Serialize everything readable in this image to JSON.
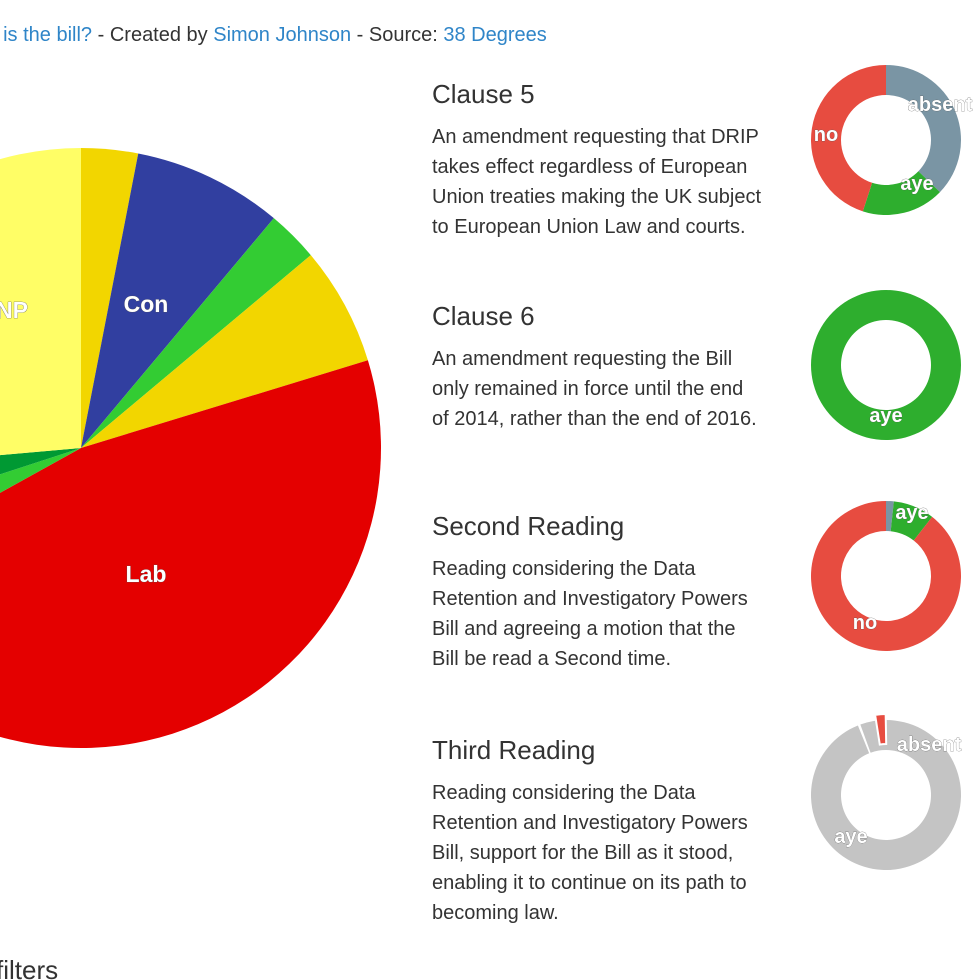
{
  "header": {
    "question_link": "t is the bill?",
    "created_by_text": " - Created by ",
    "author_link": "Simon Johnson",
    "source_text": " - Source: ",
    "source_link": "38 Degrees"
  },
  "colors": {
    "link": "#2f85c8",
    "aye": "#2eae2e",
    "no": "#e74c40",
    "absent": "#7a95a4",
    "inactive": "#c4c4c4"
  },
  "party_pie": {
    "labels": {
      "snp": "NP",
      "con": "Con",
      "lab": "Lab"
    }
  },
  "votes": [
    {
      "title": "Clause 5",
      "description": "An amendment requesting that DRIP takes effect regardless of European Union treaties making the UK subject to European Union Law and courts.",
      "labels": {
        "absent": "absent",
        "no": "no",
        "aye": "aye"
      }
    },
    {
      "title": "Clause 6",
      "description": "An amendment requesting the Bill only remained in force until the end of 2014, rather than the end of 2016.",
      "labels": {
        "aye": "aye"
      }
    },
    {
      "title": "Second Reading",
      "description": "Reading considering the Data Retention and Investigatory Powers Bill and agreeing a motion that the Bill be read a Second time.",
      "labels": {
        "aye": "aye",
        "no": "no"
      }
    },
    {
      "title": "Third Reading",
      "description": "Reading considering the Data Retention and Investigatory Powers Bill, support for the Bill as it stood, enabling it to continue on its path to becoming law.",
      "labels": {
        "absent": "absent",
        "aye": "aye"
      }
    }
  ],
  "filters": {
    "heading": "filters"
  }
}
